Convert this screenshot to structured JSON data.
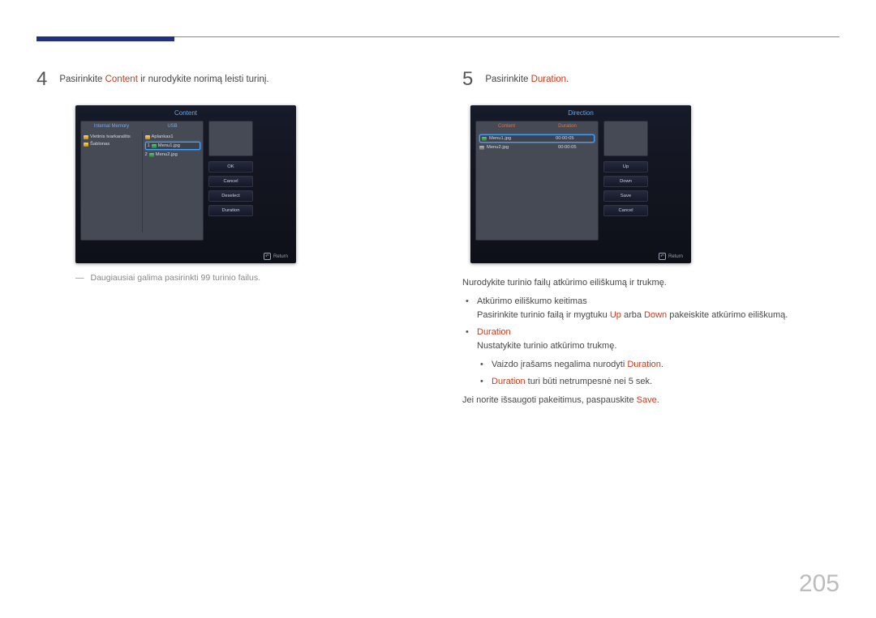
{
  "page_number": "205",
  "step4": {
    "num": "4",
    "text_pre": "Pasirinkite ",
    "text_accent": "Content",
    "text_post": " ir nurodykite norimą leisti turinį."
  },
  "step5": {
    "num": "5",
    "text_pre": "Pasirinkite ",
    "text_accent": "Duration",
    "text_post": "."
  },
  "screen_content": {
    "title": "Content",
    "tab_internal": "Internal Memory",
    "tab_usb": "USB",
    "left_items": [
      "Vietinis tvarkaraštis",
      "Šablonas"
    ],
    "right_folder": "Aplankas1",
    "file1": "Menu1.jpg",
    "file2": "Menu2.jpg",
    "idx1": "1",
    "idx2": "2",
    "btn_ok": "OK",
    "btn_cancel": "Cancel",
    "btn_deselect": "Deselect",
    "btn_duration": "Duration",
    "return": "Return"
  },
  "screen_direction": {
    "title": "Direction",
    "head_content": "Content",
    "head_duration": "Duration",
    "row1_name": "Menu1.jpg",
    "row1_dur": "00:00:05",
    "row2_name": "Menu2.jpg",
    "row2_dur": "00:00:05",
    "btn_up": "Up",
    "btn_down": "Down",
    "btn_save": "Save",
    "btn_cancel": "Cancel",
    "return": "Return"
  },
  "note4": "Daugiausiai galima pasirinkti 99 turinio failus.",
  "body5": {
    "l1": "Nurodykite turinio failų atkūrimo eiliškumą ir trukmę.",
    "b1": "Atkūrimo eiliškumo keitimas",
    "b1_pre": "Pasirinkite turinio failą ir mygtuku ",
    "b1_up": "Up",
    "b1_mid": " arba ",
    "b1_down": "Down",
    "b1_post": " pakeiskite atkūrimo eiliškumą.",
    "b2": "Duration",
    "b2_line": "Nustatykite turinio atkūrimo trukmę.",
    "s1_pre": "Vaizdo įrašams negalima nurodyti ",
    "s1_acc": "Duration",
    "s1_post": ".",
    "s2_acc": "Duration",
    "s2_post": " turi būti netrumpesnė nei 5 sek.",
    "l2_pre": "Jei norite išsaugoti pakeitimus, paspauskite ",
    "l2_acc": "Save",
    "l2_post": "."
  }
}
